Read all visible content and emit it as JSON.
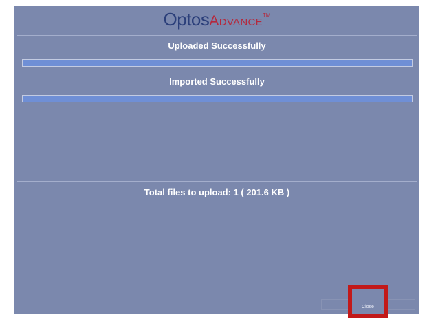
{
  "header": {
    "logo_optos": "Optos",
    "logo_advance": "Advance",
    "logo_tm": "TM"
  },
  "upload": {
    "label": "Uploaded Successfully",
    "progress": 1.0
  },
  "import": {
    "label": "Imported Successfully",
    "progress": 1.0
  },
  "summary": {
    "total_text": "Total files to upload:  1 ( 201.6 KB )"
  },
  "footer": {
    "close_label": "Close"
  },
  "colors": {
    "background": "#7b88ad",
    "bar_fill": "#6f8fd6",
    "logo_blue": "#2b3f7a",
    "logo_red": "#b5283c",
    "highlight": "#c21919"
  }
}
